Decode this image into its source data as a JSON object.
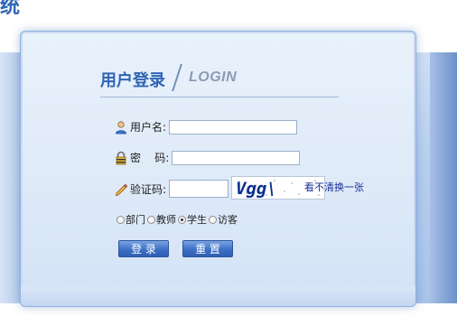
{
  "page": {
    "header_fragment": "统"
  },
  "login": {
    "title": "用户登录",
    "subtitle": "LOGIN",
    "username_label": "用户名:",
    "username_value": "",
    "password_label": "密    码:",
    "password_value": "",
    "captcha_label": "验证码:",
    "captcha_value": "",
    "captcha_text": "Vgg\\",
    "captcha_refresh": "看不清换一张",
    "roles": [
      {
        "label": "部门",
        "selected": false
      },
      {
        "label": "教师",
        "selected": false
      },
      {
        "label": "学生",
        "selected": true
      },
      {
        "label": "访客",
        "selected": false
      }
    ],
    "submit_label": "登 录",
    "reset_label": "重 置"
  },
  "colors": {
    "title_blue": "#2f65b5",
    "subtitle_gray": "#8b9cb3",
    "button_blue": "#3d6fc4",
    "link_blue": "#1a2f9a"
  },
  "icons": {
    "username": "user-icon",
    "password": "lock-icon",
    "captcha": "pencil-icon"
  }
}
